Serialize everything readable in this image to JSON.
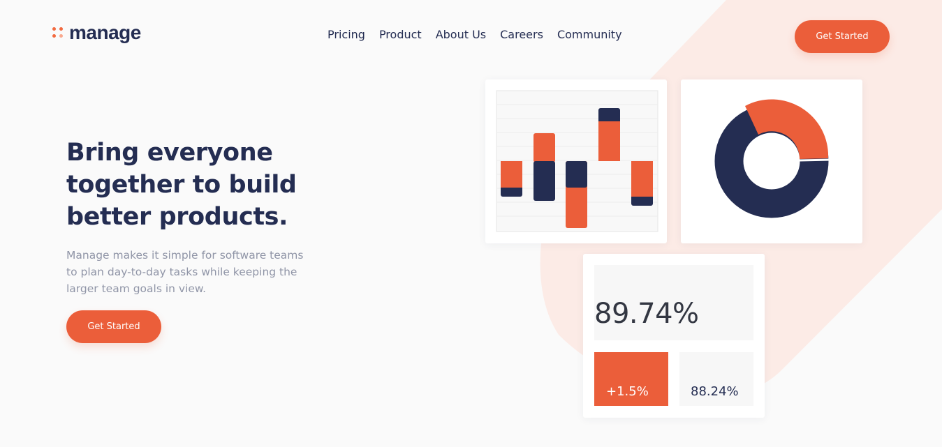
{
  "brand": {
    "name": "manage",
    "accent": "#eb5e3a",
    "navy": "#242d52"
  },
  "nav": {
    "items": [
      "Pricing",
      "Product",
      "About Us",
      "Careers",
      "Community"
    ]
  },
  "header": {
    "cta_label": "Get Started"
  },
  "hero": {
    "title": "Bring everyone together to build better products.",
    "description": "Manage makes it simple for software teams to plan day-to-day tasks while keeping the larger team goals in view.",
    "cta_label": "Get Started"
  },
  "stats": {
    "main_value": "89.74%",
    "change_value": "+1.5%",
    "secondary_value": "88.24%"
  },
  "charts": {
    "donut_orange_fraction": 0.3
  }
}
